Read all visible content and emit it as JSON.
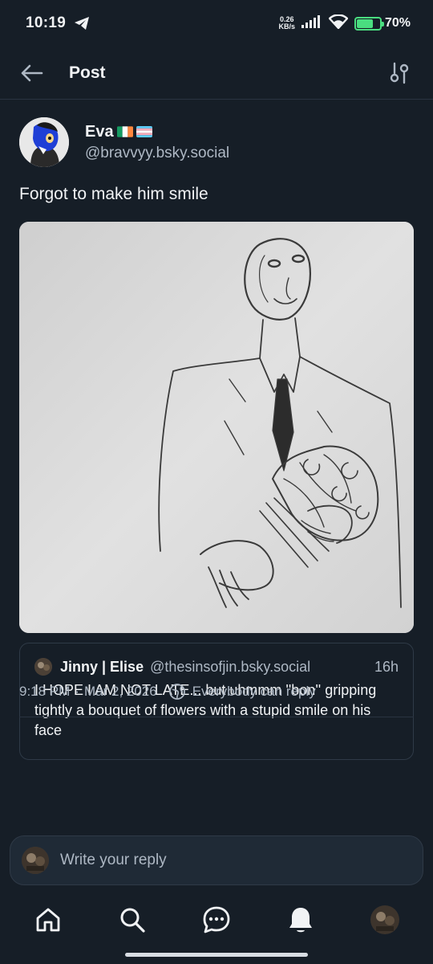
{
  "status_bar": {
    "time": "10:19",
    "net_speed_value": "0.26",
    "net_speed_unit": "KB/s",
    "battery": "70%",
    "battery_level": 0.7
  },
  "header": {
    "title": "Post"
  },
  "post": {
    "author_name": "Eva",
    "author_handle": "@bravvyy.bsky.social",
    "text": "Forgot to make him smile",
    "timestamp": "9:18 PM",
    "date": "Mar 2, 2026",
    "reply_permission": "Everybody can reply"
  },
  "quote": {
    "author_name": "Jinny | Elise",
    "author_handle": "@thesinsofjin.bsky.social",
    "time": "16h",
    "text": "I HOPE I AM NOT LATE... but uhmmm ''bon'' gripping tightly a bouquet of flowers with a stupid smile on his face"
  },
  "composer": {
    "placeholder": "Write your reply"
  },
  "nav": {
    "items": [
      "home-icon",
      "search-icon",
      "chat-icon",
      "notifications-icon",
      "profile-avatar"
    ]
  },
  "colors": {
    "background": "#161e27",
    "accent": "#208bfe",
    "battery": "#4ade80"
  }
}
